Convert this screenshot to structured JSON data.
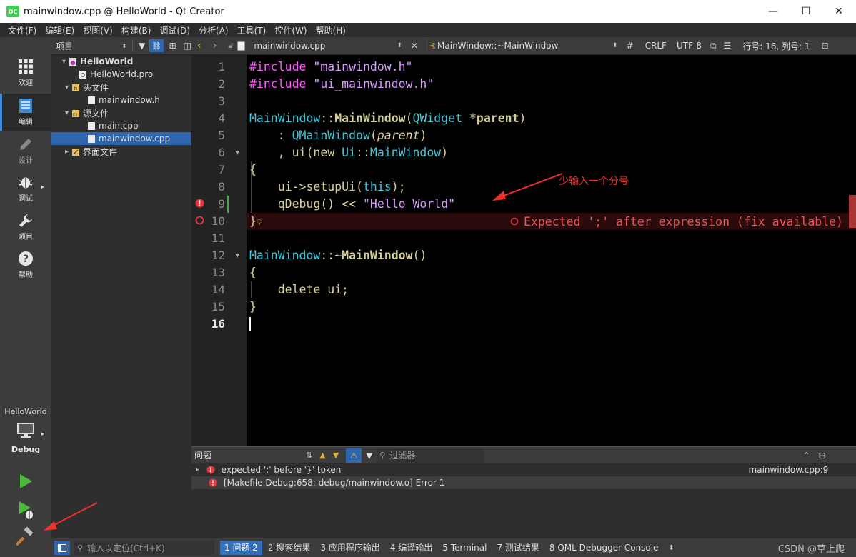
{
  "window": {
    "title": "mainwindow.cpp @ HelloWorld - Qt Creator",
    "app_icon_text": "QC",
    "minimize": "—",
    "maximize": "☐",
    "close": "✕"
  },
  "menu": [
    "文件(F)",
    "编辑(E)",
    "视图(V)",
    "构建(B)",
    "调试(D)",
    "分析(A)",
    "工具(T)",
    "控件(W)",
    "帮助(H)"
  ],
  "modes": [
    {
      "label": "欢迎",
      "icon": "grid-icon"
    },
    {
      "label": "编辑",
      "icon": "edit-doc-icon"
    },
    {
      "label": "设计",
      "icon": "pen-icon"
    },
    {
      "label": "调试",
      "icon": "bug-icon"
    },
    {
      "label": "项目",
      "icon": "wrench-icon"
    },
    {
      "label": "帮助",
      "icon": "help-icon"
    }
  ],
  "kit": {
    "project": "HelloWorld",
    "config": "Debug"
  },
  "project_panel": {
    "title": "项目",
    "tree": [
      {
        "label": "HelloWorld",
        "indent": 1,
        "arrow": "▾",
        "bold": true,
        "icon": "project"
      },
      {
        "label": "HelloWorld.pro",
        "indent": 2,
        "arrow": "",
        "bold": false,
        "icon": "pro"
      },
      {
        "label": "头文件",
        "indent": 2,
        "arrow": "▾",
        "bold": false,
        "icon": "folder-h"
      },
      {
        "label": "mainwindow.h",
        "indent": 3,
        "arrow": "",
        "bold": false,
        "icon": "file"
      },
      {
        "label": "源文件",
        "indent": 2,
        "arrow": "▾",
        "bold": false,
        "icon": "folder-cpp"
      },
      {
        "label": "main.cpp",
        "indent": 3,
        "arrow": "",
        "bold": false,
        "icon": "file"
      },
      {
        "label": "mainwindow.cpp",
        "indent": 3,
        "arrow": "",
        "bold": false,
        "icon": "file",
        "selected": true
      },
      {
        "label": "界面文件",
        "indent": 2,
        "arrow": "▸",
        "bold": false,
        "icon": "folder-ui"
      }
    ]
  },
  "editor_toolbar": {
    "file": "mainwindow.cpp",
    "symbol": "MainWindow::~MainWindow",
    "hash": "#",
    "line_ending": "CRLF",
    "encoding": "UTF-8",
    "position": "行号: 16, 列号: 1"
  },
  "code_lines": [
    "1",
    "2",
    "3",
    "4",
    "5",
    "6",
    "7",
    "8",
    "9",
    "10",
    "11",
    "12",
    "13",
    "14",
    "15",
    "16"
  ],
  "code": {
    "l1_a": "#include",
    "l1_b": "\"mainwindow.h\"",
    "l2_a": "#include",
    "l2_b": "\"ui_mainwindow.h\"",
    "l4_a": "MainWindow",
    "l4_b": "::",
    "l4_c": "MainWindow",
    "l4_d": "(",
    "l4_e": "QWidget",
    "l4_f": " *",
    "l4_g": "parent",
    "l4_h": ")",
    "l5_a": "    : ",
    "l5_b": "QMainWindow",
    "l5_c": "(",
    "l5_d": "parent",
    "l5_e": ")",
    "l6_a": "    , ui(new ",
    "l6_b": "Ui",
    "l6_c": "::",
    "l6_d": "MainWindow",
    "l6_e": ")",
    "l7": "{",
    "l8_a": "    ui->setupUi(",
    "l8_b": "this",
    "l8_c": ");",
    "l9_a": "    qDebug() << ",
    "l9_b": "\"Hello World\"",
    "l10": "}",
    "l12_a": "MainWindow",
    "l12_b": "::~",
    "l12_c": "MainWindow",
    "l12_d": "()",
    "l13": "{",
    "l14": "    delete ui;",
    "l15": "}"
  },
  "inline_error": "Expected ';' after expression (fix available)",
  "annotation": "少输入一个分号",
  "issues": {
    "title": "问题",
    "filter_placeholder": "过滤器",
    "items": [
      {
        "text": "expected ';' before '}' token",
        "location": "mainwindow.cpp:9"
      },
      {
        "text": "[Makefile.Debug:658: debug/mainwindow.o] Error 1",
        "location": ""
      }
    ]
  },
  "bottom": {
    "locator_placeholder": "输入以定位(Ctrl+K)",
    "tabs": [
      "1 问题 2",
      "2 搜索结果",
      "3 应用程序输出",
      "4 编译输出",
      "5 Terminal",
      "7 测试结果",
      "8 QML Debugger Console"
    ],
    "watermark": "CSDN @草上爬"
  },
  "colors": {
    "accent": "#3e8ad6",
    "error": "#e0383e",
    "selection": "#2f65ad",
    "run_green": "#4bba3b"
  }
}
